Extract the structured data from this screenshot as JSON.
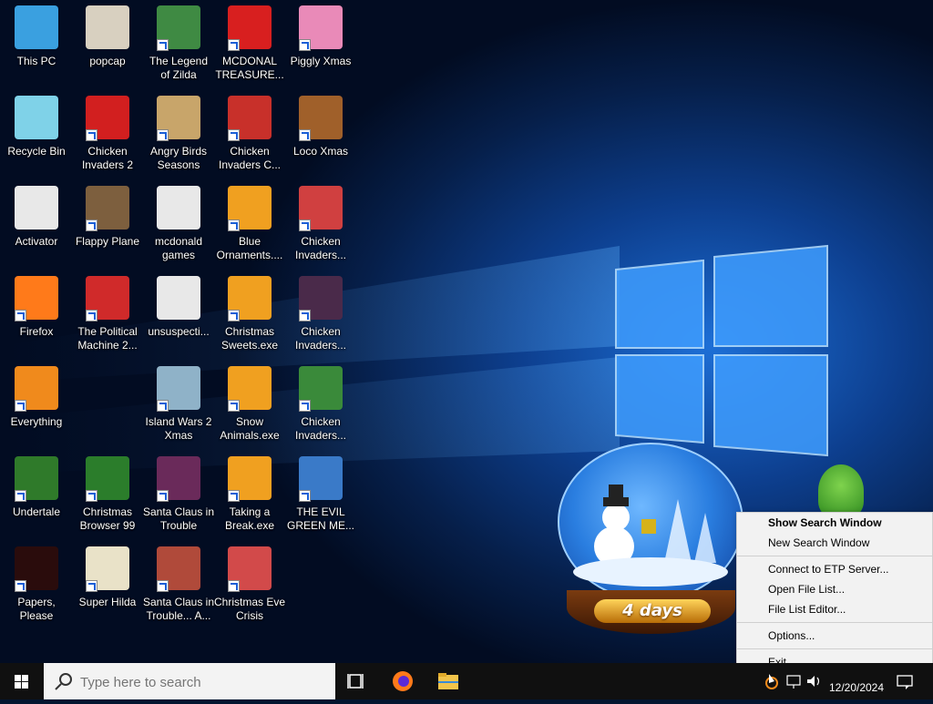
{
  "desktop": {
    "icons": [
      {
        "label": "This PC",
        "color": "#3aa0e0",
        "shortcut": false
      },
      {
        "label": "Recycle Bin",
        "color": "#7fd2e8",
        "shortcut": false
      },
      {
        "label": "Activator",
        "color": "#e8e8e8",
        "shortcut": false
      },
      {
        "label": "Firefox",
        "color": "#ff7a1a",
        "shortcut": true
      },
      {
        "label": "Everything",
        "color": "#f08a1c",
        "shortcut": true
      },
      {
        "label": "Undertale",
        "color": "#2f7a2a",
        "shortcut": true
      },
      {
        "label": "Papers, Please",
        "color": "#2a0c0c",
        "shortcut": true
      },
      {
        "label": "popcap",
        "color": "#d8d0c0",
        "shortcut": false
      },
      {
        "label": "Chicken\nInvaders 2",
        "color": "#d21f1f",
        "shortcut": true
      },
      {
        "label": "Flappy Plane",
        "color": "#7d5f3e",
        "shortcut": true
      },
      {
        "label": "The Political\nMachine 2...",
        "color": "#d02a2a",
        "shortcut": true
      },
      {
        "label": "Christmas\nBrowser 99",
        "color": "#2b7d2b",
        "shortcut": true
      },
      {
        "label": "Super Hilda",
        "color": "#e9e2c8",
        "shortcut": true
      },
      {
        "label": "The Legend\nof Zilda",
        "color": "#3f8a43",
        "shortcut": true
      },
      {
        "label": "Angry Birds\nSeasons",
        "color": "#c8a56a",
        "shortcut": true
      },
      {
        "label": "mcdonald\ngames",
        "color": "#e8e8e8",
        "shortcut": false
      },
      {
        "label": "unsuspecti...",
        "color": "#e8e8e8",
        "shortcut": false
      },
      {
        "label": "Island Wars 2\nXmas",
        "color": "#8fb2c8",
        "shortcut": true
      },
      {
        "label": "Santa Claus in\nTrouble",
        "color": "#6a2a5a",
        "shortcut": true
      },
      {
        "label": "Santa Claus in\nTrouble... A...",
        "color": "#b04a3a",
        "shortcut": true
      },
      {
        "label": "MCDONAL\nTREASURE...",
        "color": "#d81f1f",
        "shortcut": true
      },
      {
        "label": "Chicken\nInvaders C...",
        "color": "#c8302a",
        "shortcut": true
      },
      {
        "label": "Blue\nOrnaments....",
        "color": "#f0a020",
        "shortcut": true
      },
      {
        "label": "Christmas\nSweets.exe",
        "color": "#f0a020",
        "shortcut": true
      },
      {
        "label": "Snow\nAnimals.exe",
        "color": "#f0a020",
        "shortcut": true
      },
      {
        "label": "Taking a\nBreak.exe",
        "color": "#f0a020",
        "shortcut": true
      },
      {
        "label": "Christmas Eve\nCrisis",
        "color": "#d24a4a",
        "shortcut": true
      },
      {
        "label": "Piggly Xmas",
        "color": "#e98ab8",
        "shortcut": true
      },
      {
        "label": "Loco Xmas",
        "color": "#a0602a",
        "shortcut": true
      },
      {
        "label": "Chicken\nInvaders...",
        "color": "#d04040",
        "shortcut": true
      },
      {
        "label": "Chicken\nInvaders...",
        "color": "#4a2a4a",
        "shortcut": true
      },
      {
        "label": "Chicken\nInvaders...",
        "color": "#3a8a3a",
        "shortcut": true
      },
      {
        "label": "THE EVIL\nGREEN ME...",
        "color": "#3a7ac8",
        "shortcut": true
      }
    ]
  },
  "widget": {
    "countdown": "4 days"
  },
  "context_menu": {
    "items": [
      {
        "label": "Show Search Window",
        "bold": true
      },
      {
        "label": "New Search Window"
      },
      {
        "sep": true
      },
      {
        "label": "Connect to ETP Server..."
      },
      {
        "label": "Open File List..."
      },
      {
        "label": "File List Editor..."
      },
      {
        "sep": true
      },
      {
        "label": "Options..."
      },
      {
        "sep": true
      },
      {
        "label": "Exit"
      }
    ]
  },
  "taskbar": {
    "search_placeholder": "Type here to search",
    "clock_date": "12/20/2024",
    "icons": [
      "windows-start-icon",
      "task-view-icon",
      "firefox-icon",
      "file-explorer-icon"
    ],
    "tray_icons": [
      "everything-tray-icon",
      "network-icon",
      "volume-icon",
      "notification-icon"
    ]
  },
  "colors": {
    "taskbar": "#101010",
    "menu_bg": "#f2f2f2"
  }
}
